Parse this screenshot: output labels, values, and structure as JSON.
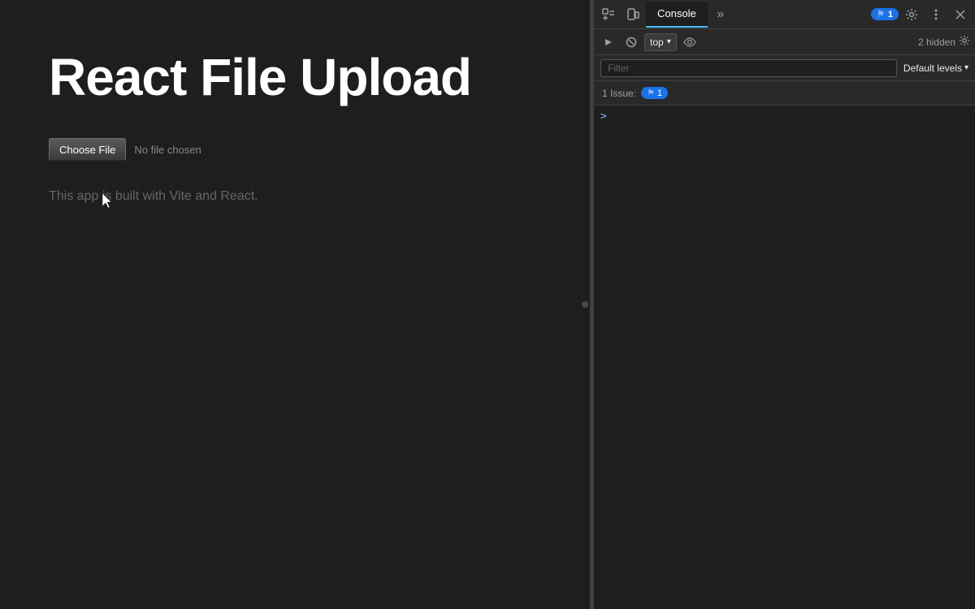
{
  "app": {
    "title": "React File Upload",
    "subtitle": "This app is built with Vite and React.",
    "file_input": {
      "button_label": "Choose File",
      "no_file_text": "No file chosen"
    }
  },
  "devtools": {
    "tabs": {
      "console_label": "Console",
      "more_label": "»"
    },
    "badge": {
      "count": "1",
      "flag": "⚑"
    },
    "toolbar": {
      "context_label": "top",
      "context_arrow": "▾",
      "hidden_label": "2 hidden",
      "filter_placeholder": "Filter",
      "default_levels_label": "Default levels",
      "default_levels_arrow": "▾"
    },
    "issues": {
      "label": "1 Issue:",
      "flag": "⚑",
      "count": "1"
    },
    "console_arrow": ">"
  }
}
